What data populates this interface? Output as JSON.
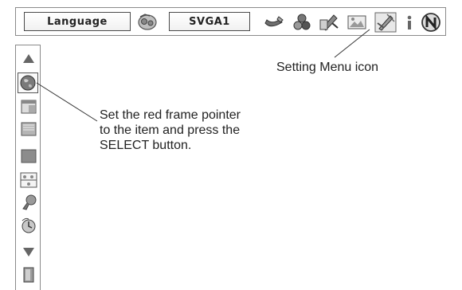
{
  "toolbar": {
    "language_label": "Language",
    "source_label": "SVGA1",
    "icons": [
      "audio-icon",
      "image-adjust-icon",
      "color-adjust-icon",
      "screen-icon",
      "picture-icon",
      "setting-menu-icon",
      "information-icon",
      "network-icon"
    ]
  },
  "sidebar": {
    "icons": [
      "scroll-up-icon",
      "globe-language-icon",
      "screen-settings-icon",
      "keypad-icon",
      "background-icon",
      "display-icon",
      "lamp-icon",
      "power-management-icon",
      "scroll-down-icon",
      "exit-icon"
    ],
    "selected_index": 1
  },
  "annotations": {
    "setting_menu": "Setting Menu icon",
    "pointer_line1": "Set the red frame pointer",
    "pointer_line2": "to the item and press the",
    "pointer_line3": "SELECT button."
  }
}
